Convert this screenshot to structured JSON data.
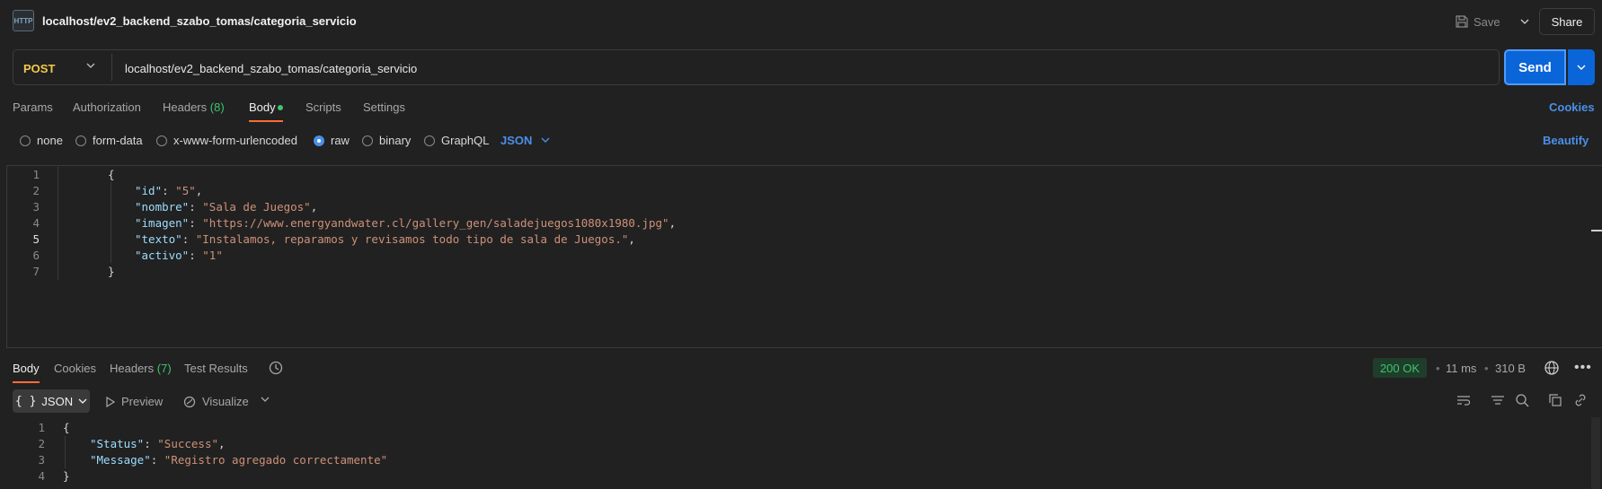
{
  "tab": {
    "icon_text": "HTTP",
    "title": "localhost/ev2_backend_szabo_tomas/categoria_servicio"
  },
  "toolbar": {
    "save_label": "Save",
    "share_label": "Share"
  },
  "request": {
    "method": "POST",
    "url": "localhost/ev2_backend_szabo_tomas/categoria_servicio",
    "send_label": "Send"
  },
  "request_tabs": {
    "params": "Params",
    "authorization": "Authorization",
    "headers": "Headers",
    "headers_count": "(8)",
    "body": "Body",
    "scripts": "Scripts",
    "settings": "Settings",
    "cookies": "Cookies"
  },
  "body_types": {
    "none": "none",
    "form_data": "form-data",
    "urlencoded": "x-www-form-urlencoded",
    "raw": "raw",
    "binary": "binary",
    "graphql": "GraphQL",
    "selected_format": "JSON",
    "beautify": "Beautify"
  },
  "request_body": {
    "line_numbers": [
      "1",
      "2",
      "3",
      "4",
      "5",
      "6",
      "7"
    ],
    "open_brace": "{",
    "close_brace": "}",
    "fields": [
      {
        "key": "\"id\"",
        "value": "\"5\"",
        "trail": ","
      },
      {
        "key": "\"nombre\"",
        "value": "\"Sala de Juegos\"",
        "trail": ","
      },
      {
        "key": "\"imagen\"",
        "value": "\"https://www.energyandwater.cl/gallery_gen/saladejuegos1080x1980.jpg\"",
        "trail": ","
      },
      {
        "key": "\"texto\"",
        "value": "\"Instalamos, reparamos y revisamos todo tipo de sala de Juegos.\"",
        "trail": ","
      },
      {
        "key": "\"activo\"",
        "value": "\"1\"",
        "trail": ""
      }
    ]
  },
  "response_tabs": {
    "body": "Body",
    "cookies": "Cookies",
    "headers": "Headers",
    "headers_count": "(7)",
    "test_results": "Test Results"
  },
  "response_meta": {
    "status": "200 OK",
    "time": "11 ms",
    "size": "310 B",
    "status_color": "#3ec46d"
  },
  "response_view": {
    "format": "JSON",
    "preview": "Preview",
    "visualize": "Visualize"
  },
  "response_body": {
    "line_numbers": [
      "1",
      "2",
      "3",
      "4"
    ],
    "open_brace": "{",
    "close_brace": "}",
    "fields": [
      {
        "key": "\"Status\"",
        "value": "\"Success\"",
        "trail": ","
      },
      {
        "key": "\"Message\"",
        "value": "\"Registro agregado correctamente\"",
        "trail": ""
      }
    ]
  },
  "colors": {
    "accent": "#ff6c37",
    "link": "#4b8fe8",
    "send": "#0a65d8",
    "method": "#f2c94c"
  }
}
